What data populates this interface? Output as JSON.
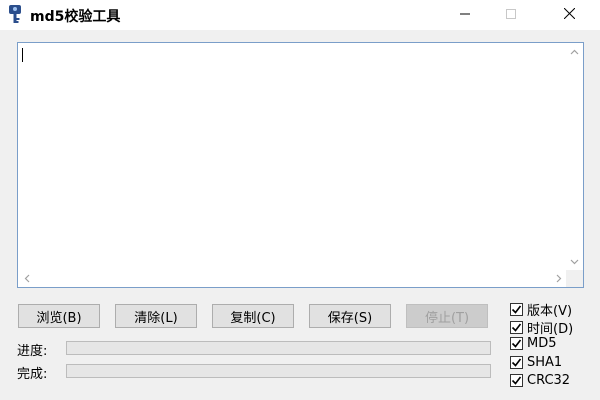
{
  "window": {
    "title": "md5校验工具",
    "controls": [
      "minimize",
      "maximize",
      "close"
    ]
  },
  "editor": {
    "value": ""
  },
  "buttons": {
    "browse": "浏览(B)",
    "clear": "清除(L)",
    "copy": "复制(C)",
    "save": "保存(S)",
    "stop": "停止(T)"
  },
  "progress": {
    "progress_label": "进度:",
    "complete_label": "完成:",
    "progress_value": 0,
    "complete_value": 0
  },
  "options": [
    {
      "label": "版本(V)",
      "checked": true
    },
    {
      "label": "时间(D)",
      "checked": true
    },
    {
      "label": "MD5",
      "checked": true
    },
    {
      "label": "SHA1",
      "checked": true
    },
    {
      "label": "CRC32",
      "checked": true
    }
  ],
  "icons": {
    "app": "key-icon",
    "minimize": "minimize-icon",
    "maximize": "maximize-icon",
    "close": "close-icon"
  },
  "colors": {
    "accent_border": "#7a9ec9",
    "progress_fill": "#06b025"
  }
}
